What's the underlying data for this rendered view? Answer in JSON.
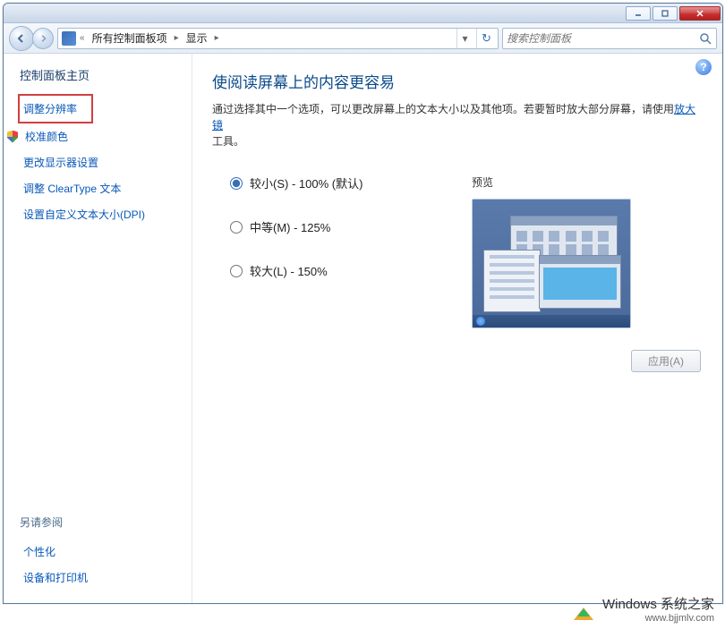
{
  "breadcrumb": {
    "sep0": "«",
    "item1": "所有控制面板项",
    "sep1": "▸",
    "item2": "显示",
    "sep2": "▸"
  },
  "search": {
    "placeholder": "搜索控制面板"
  },
  "sidebar": {
    "home": "控制面板主页",
    "links": {
      "resolution": "调整分辨率",
      "calibrate": "校准颜色",
      "monitor": "更改显示器设置",
      "cleartype": "调整 ClearType 文本",
      "custom_dpi": "设置自定义文本大小(DPI)"
    },
    "see_also": "另请参阅",
    "bottom": {
      "personalize": "个性化",
      "devices": "设备和打印机"
    }
  },
  "content": {
    "title": "使阅读屏幕上的内容更容易",
    "desc_pre": "通过选择其中一个选项，可以更改屏幕上的文本大小以及其他项。若要暂时放大部分屏幕，请使用",
    "magnifier_link": "放大镜",
    "desc_post": "工具。",
    "radios": {
      "small": "较小(S) - 100% (默认)",
      "medium": "中等(M) - 125%",
      "large": "较大(L) - 150%"
    },
    "preview_label": "预览",
    "apply_btn": "应用(A)"
  },
  "watermark": {
    "main": "Windows 系统之家",
    "sub": "www.bjjmlv.com"
  }
}
